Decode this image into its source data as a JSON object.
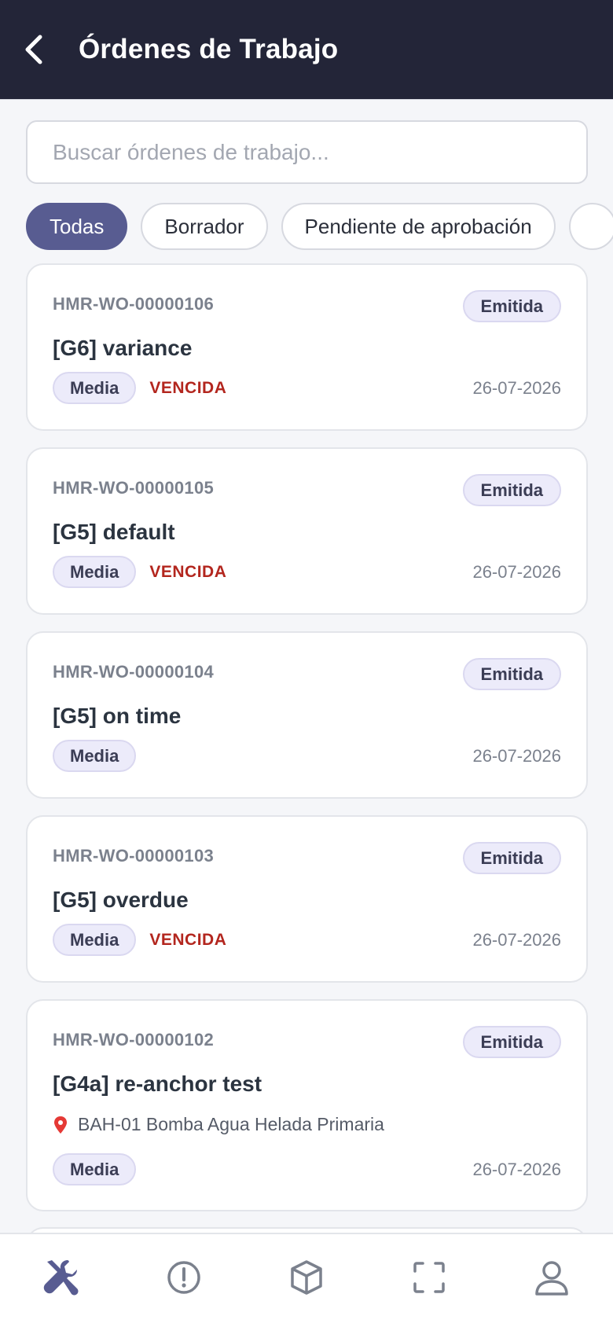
{
  "header": {
    "title": "Órdenes de Trabajo",
    "back_icon": "chevron-left-icon"
  },
  "search": {
    "placeholder": "Buscar órdenes de trabajo...",
    "value": ""
  },
  "filters": [
    {
      "label": "Todas",
      "active": true
    },
    {
      "label": "Borrador",
      "active": false
    },
    {
      "label": "Pendiente de aprobación",
      "active": false
    }
  ],
  "work_orders": [
    {
      "code": "HMR-WO-00000106",
      "status": "Emitida",
      "title": "[G6] variance",
      "location": "",
      "priority": "Media",
      "overdue": "VENCIDA",
      "date": "26-07-2026"
    },
    {
      "code": "HMR-WO-00000105",
      "status": "Emitida",
      "title": "[G5] default",
      "location": "",
      "priority": "Media",
      "overdue": "VENCIDA",
      "date": "26-07-2026"
    },
    {
      "code": "HMR-WO-00000104",
      "status": "Emitida",
      "title": "[G5] on time",
      "location": "",
      "priority": "Media",
      "overdue": "",
      "date": "26-07-2026"
    },
    {
      "code": "HMR-WO-00000103",
      "status": "Emitida",
      "title": "[G5] overdue",
      "location": "",
      "priority": "Media",
      "overdue": "VENCIDA",
      "date": "26-07-2026"
    },
    {
      "code": "HMR-WO-00000102",
      "status": "Emitida",
      "title": "[G4a] re-anchor test",
      "location": "BAH-01 Bomba Agua Helada Primaria",
      "priority": "Media",
      "overdue": "",
      "date": "26-07-2026"
    }
  ],
  "bottom_nav": [
    {
      "icon": "tools-icon",
      "active": true
    },
    {
      "icon": "alert-circle-icon",
      "active": false
    },
    {
      "icon": "box-icon",
      "active": false
    },
    {
      "icon": "scan-icon",
      "active": false
    },
    {
      "icon": "user-icon",
      "active": false
    }
  ],
  "colors": {
    "header_bg": "#232538",
    "accent": "#585c91",
    "overdue": "#b3261e",
    "badge_bg": "#ecebfa",
    "location_pin": "#e53935"
  }
}
